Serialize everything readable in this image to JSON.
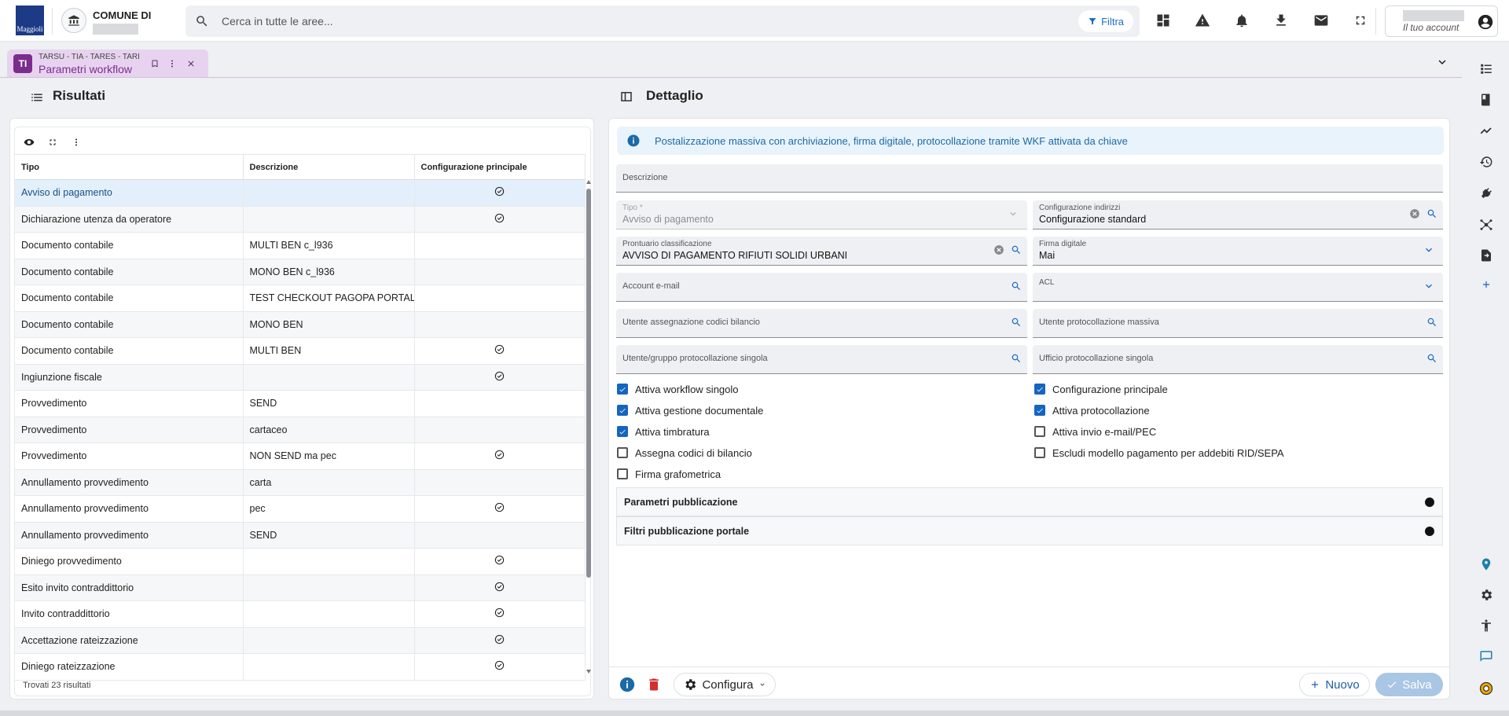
{
  "header": {
    "logo_text": "Maggioli",
    "comune_title": "COMUNE DI",
    "search_placeholder": "Cerca in tutte le aree...",
    "filter_label": "Filtra",
    "account_label": "Il tuo account"
  },
  "tab": {
    "supertitle": "TARSU - TIA - TARES - TARI",
    "title": "Parametri workflow",
    "icon_text": "TI"
  },
  "results": {
    "title": "Risultati",
    "columns": [
      "Tipo",
      "Descrizione",
      "Configurazione principale"
    ],
    "rows": [
      {
        "tipo": "Avviso di pagamento",
        "descrizione": "",
        "principale": true
      },
      {
        "tipo": "Dichiarazione utenza da operatore",
        "descrizione": "",
        "principale": true
      },
      {
        "tipo": "Documento contabile",
        "descrizione": "MULTI BEN c_l936",
        "principale": false
      },
      {
        "tipo": "Documento contabile",
        "descrizione": "MONO BEN c_l936",
        "principale": false
      },
      {
        "tipo": "Documento contabile",
        "descrizione": "TEST CHECKOUT PAGOPA PORTALE",
        "principale": false
      },
      {
        "tipo": "Documento contabile",
        "descrizione": "MONO BEN",
        "principale": false
      },
      {
        "tipo": "Documento contabile",
        "descrizione": "MULTI BEN",
        "principale": true
      },
      {
        "tipo": "Ingiunzione fiscale",
        "descrizione": "",
        "principale": true
      },
      {
        "tipo": "Provvedimento",
        "descrizione": "SEND",
        "principale": false
      },
      {
        "tipo": "Provvedimento",
        "descrizione": "cartaceo",
        "principale": false
      },
      {
        "tipo": "Provvedimento",
        "descrizione": "NON SEND ma pec",
        "principale": true
      },
      {
        "tipo": "Annullamento provvedimento",
        "descrizione": "carta",
        "principale": false
      },
      {
        "tipo": "Annullamento provvedimento",
        "descrizione": "pec",
        "principale": true
      },
      {
        "tipo": "Annullamento provvedimento",
        "descrizione": "SEND",
        "principale": false
      },
      {
        "tipo": "Diniego provvedimento",
        "descrizione": "",
        "principale": true
      },
      {
        "tipo": "Esito invito contraddittorio",
        "descrizione": "",
        "principale": true
      },
      {
        "tipo": "Invito contraddittorio",
        "descrizione": "",
        "principale": true
      },
      {
        "tipo": "Accettazione rateizzazione",
        "descrizione": "",
        "principale": true
      },
      {
        "tipo": "Diniego rateizzazione",
        "descrizione": "",
        "principale": true
      }
    ],
    "found_text": "Trovati 23 risultati"
  },
  "detail": {
    "title": "Dettaglio",
    "info_text": "Postalizzazione massiva con archiviazione, firma digitale, protocollazione tramite WKF attivata da chiave",
    "fields": {
      "descrizione": {
        "label": "Descrizione",
        "value": ""
      },
      "tipo": {
        "label": "Tipo *",
        "value": "Avviso di pagamento"
      },
      "configurazione_indirizzi": {
        "label": "Configurazione indirizzi",
        "value": "Configurazione standard"
      },
      "prontuario": {
        "label": "Prontuario classificazione",
        "value": "AVVISO DI PAGAMENTO RIFIUTI SOLIDI URBANI"
      },
      "firma_digitale": {
        "label": "Firma digitale",
        "value": "Mai"
      },
      "account_email": {
        "label": "Account e-mail",
        "value": ""
      },
      "acl": {
        "label": "ACL",
        "value": ""
      },
      "utente_bilancio": {
        "label": "Utente assegnazione codici bilancio",
        "value": ""
      },
      "utente_prot_massiva": {
        "label": "Utente protocollazione massiva",
        "value": ""
      },
      "utente_prot_singola": {
        "label": "Utente/gruppo protocollazione singola",
        "value": ""
      },
      "ufficio_prot_singola": {
        "label": "Ufficio protocollazione singola",
        "value": ""
      }
    },
    "checkboxes_left": [
      {
        "label": "Attiva workflow singolo",
        "checked": true
      },
      {
        "label": "Attiva gestione documentale",
        "checked": true
      },
      {
        "label": "Attiva timbratura",
        "checked": true
      },
      {
        "label": "Assegna codici di bilancio",
        "checked": false
      },
      {
        "label": "Firma grafometrica",
        "checked": false
      }
    ],
    "checkboxes_right": [
      {
        "label": "Configurazione principale",
        "checked": true
      },
      {
        "label": "Attiva protocollazione",
        "checked": true
      },
      {
        "label": "Attiva invio e-mail/PEC",
        "checked": false
      },
      {
        "label": "Escludi modello pagamento per addebiti RID/SEPA",
        "checked": false
      }
    ],
    "accordions": [
      "Parametri pubblicazione",
      "Filtri pubblicazione portale"
    ],
    "buttons": {
      "configura": "Configura",
      "nuovo": "Nuovo",
      "salva": "Salva"
    }
  },
  "colors": {
    "accent": "#1565c0",
    "tab_bg": "#e7d3ef",
    "tab_accent": "#7b2d8e",
    "info_bg": "#e9f3fb",
    "delete": "#d32f2f"
  }
}
